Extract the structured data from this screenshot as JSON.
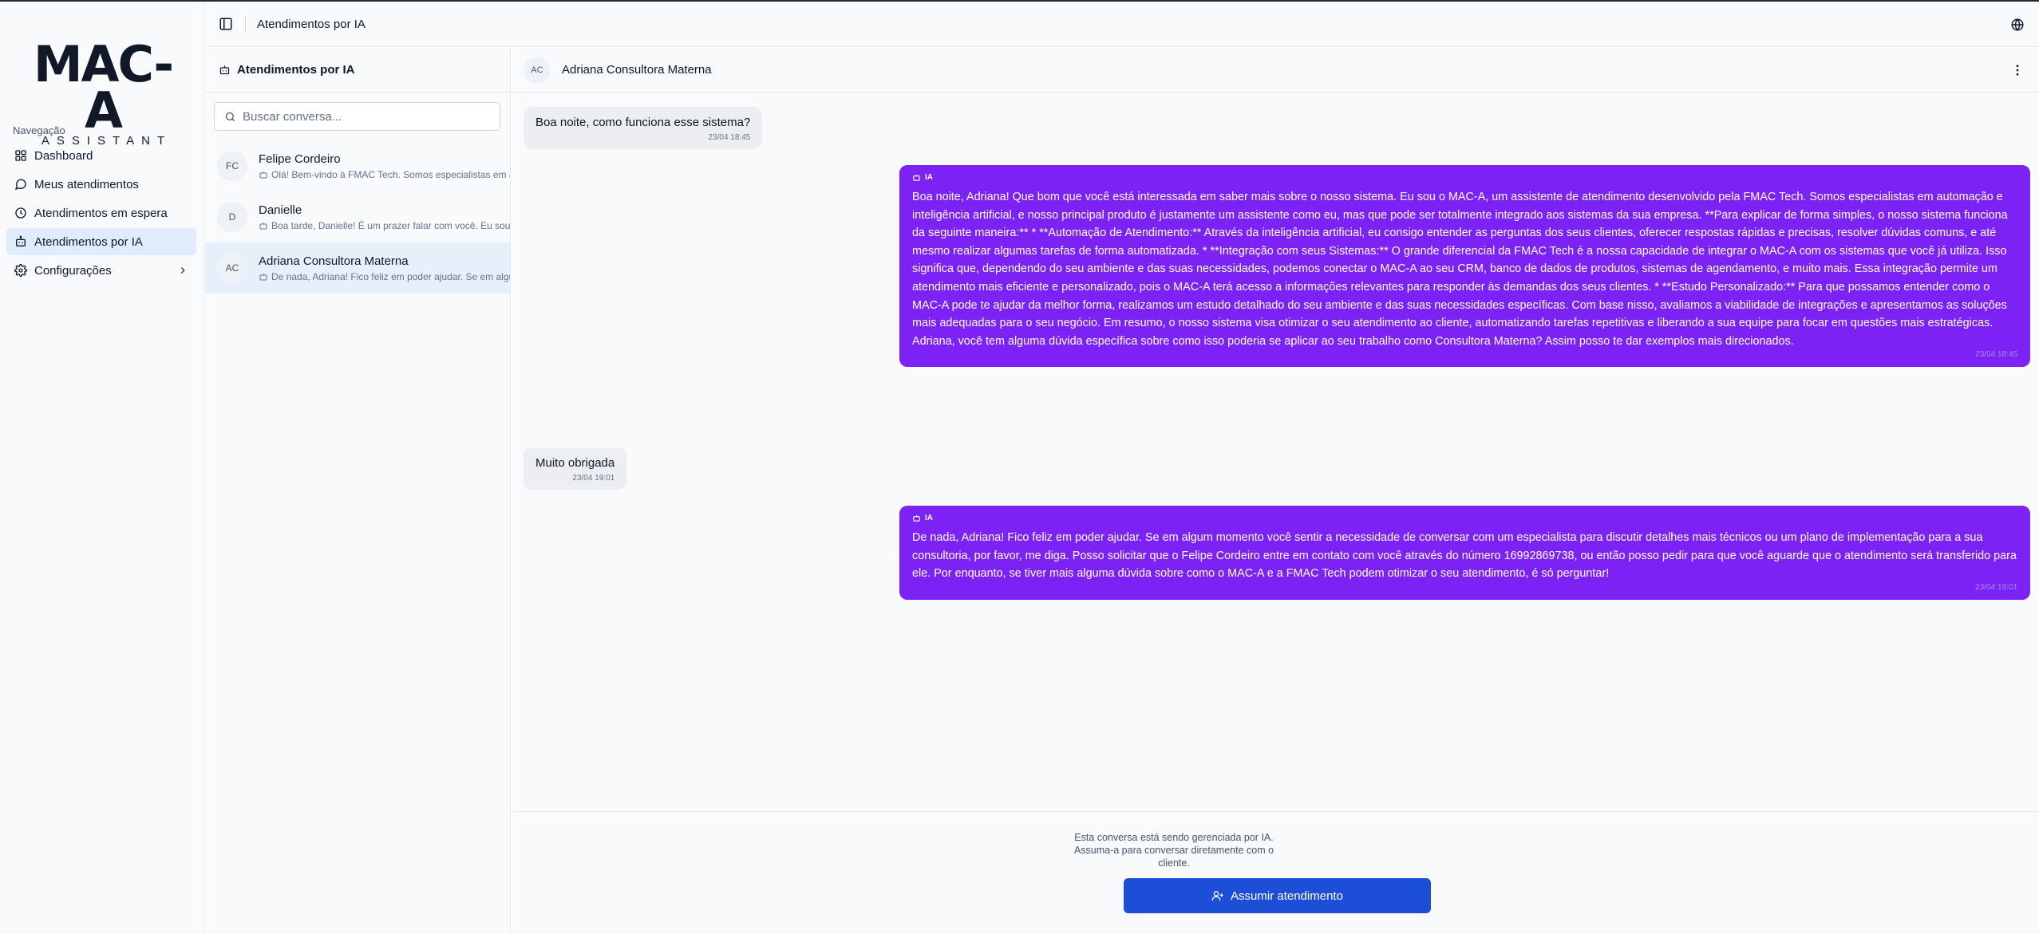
{
  "app": {
    "logo_text": "MAC-A",
    "logo_subtext": "ASSISTANT"
  },
  "sidebar": {
    "section_label": "Navegação",
    "items": [
      {
        "label": "Dashboard",
        "icon": "grid-icon"
      },
      {
        "label": "Meus atendimentos",
        "icon": "message-circle-icon"
      },
      {
        "label": "Atendimentos em espera",
        "icon": "clock-icon"
      },
      {
        "label": "Atendimentos por IA",
        "icon": "bot-icon",
        "active": true
      },
      {
        "label": "Configurações",
        "icon": "gear-icon",
        "has_submenu": true
      }
    ]
  },
  "topbar": {
    "title": "Atendimentos por IA"
  },
  "conversations": {
    "header": "Atendimentos por IA",
    "search_placeholder": "Buscar conversa...",
    "items": [
      {
        "initials": "FC",
        "name": "Felipe Cordeiro",
        "preview": "Olá! Bem-vindo à FMAC Tech. Somos especialistas em automação"
      },
      {
        "initials": "D",
        "name": "Danielle",
        "preview": "Boa tarde, Danielle! É um prazer falar com você. Eu sou o MAC-A"
      },
      {
        "initials": "AC",
        "name": "Adriana Consultora Materna",
        "preview": "De nada, Adriana! Fico feliz em poder ajudar. Se em algum momento",
        "active": true
      }
    ]
  },
  "chat": {
    "contact_initials": "AC",
    "contact_name": "Adriana Consultora Materna",
    "messages": [
      {
        "from": "user",
        "text": "Boa noite, como funciona esse sistema?",
        "time": "23/04 18:45"
      },
      {
        "from": "ai",
        "tag": "IA",
        "text": "Boa noite, Adriana! Que bom que você está interessada em saber mais sobre o nosso sistema. Eu sou o MAC-A, um assistente de atendimento desenvolvido pela FMAC Tech. Somos especialistas em automação e inteligência artificial, e nosso principal produto é justamente um assistente como eu, mas que pode ser totalmente integrado aos sistemas da sua empresa. **Para explicar de forma simples, o nosso sistema funciona da seguinte maneira:** * **Automação de Atendimento:** Através da inteligência artificial, eu consigo entender as perguntas dos seus clientes, oferecer respostas rápidas e precisas, resolver dúvidas comuns, e até mesmo realizar algumas tarefas de forma automatizada. * **Integração com seus Sistemas:** O grande diferencial da FMAC Tech é a nossa capacidade de integrar o MAC-A com os sistemas que você já utiliza. Isso significa que, dependendo do seu ambiente e das suas necessidades, podemos conectar o MAC-A ao seu CRM, banco de dados de produtos, sistemas de agendamento, e muito mais. Essa integração permite um atendimento mais eficiente e personalizado, pois o MAC-A terá acesso a informações relevantes para responder às demandas dos seus clientes. * **Estudo Personalizado:** Para que possamos entender como o MAC-A pode te ajudar da melhor forma, realizamos um estudo detalhado do seu ambiente e das suas necessidades específicas. Com base nisso, avaliamos a viabilidade de integrações e apresentamos as soluções mais adequadas para o seu negócio. Em resumo, o nosso sistema visa otimizar o seu atendimento ao cliente, automatizando tarefas repetitivas e liberando a sua equipe para focar em questões mais estratégicas. Adriana, você tem alguma dúvida específica sobre como isso poderia se aplicar ao seu trabalho como Consultora Materna? Assim posso te dar exemplos mais direcionados.",
        "time": "23/04 18:45"
      },
      {
        "from": "user",
        "text": "Muito obrigada",
        "time": "23/04 19:01"
      },
      {
        "from": "ai",
        "tag": "IA",
        "text": "De nada, Adriana! Fico feliz em poder ajudar. Se em algum momento você sentir a necessidade de conversar com um especialista para discutir detalhes mais técnicos ou um plano de implementação para a sua consultoria, por favor, me diga. Posso solicitar que o Felipe Cordeiro entre em contato com você através do número 16992869738, ou então posso pedir para que você aguarde que o atendimento será transferido para ele. Por enquanto, se tiver mais alguma dúvida sobre como o MAC-A e a FMAC Tech podem otimizar o seu atendimento, é só perguntar!",
        "time": "23/04 19:01"
      }
    ],
    "footer_note_lines": [
      "Esta conversa está sendo gerenciada por IA.",
      "Assuma-a para conversar diretamente com o",
      "cliente."
    ],
    "assume_button": "Assumir atendimento"
  },
  "colors": {
    "accent_blue": "#1d4ed8",
    "ai_bubble": "#7c22f5",
    "active_nav": "#e0ecfb"
  }
}
